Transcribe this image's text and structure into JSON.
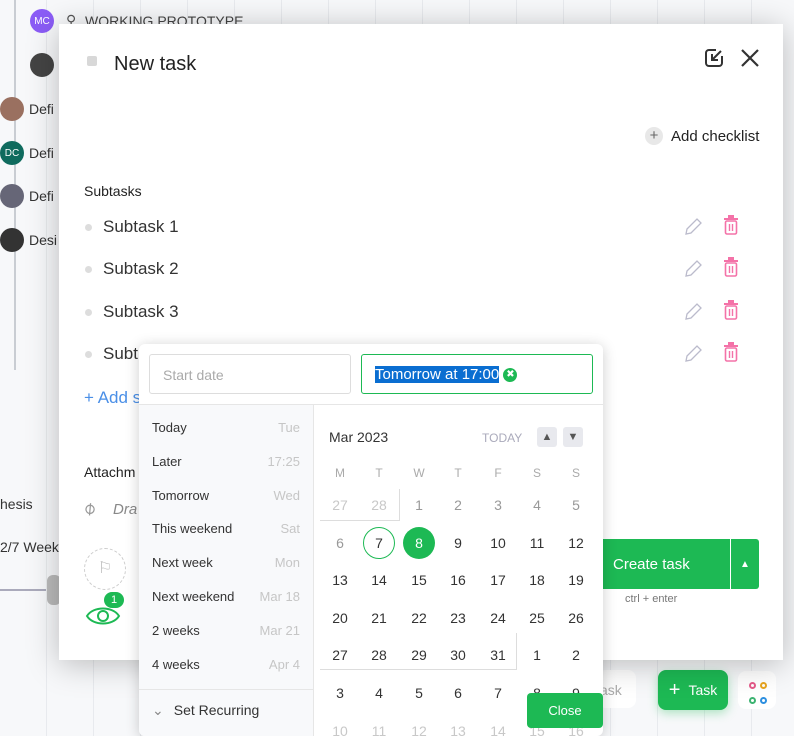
{
  "background": {
    "project_label": "WORKING PROTOTYPE",
    "avatars": [
      {
        "initials": "MC",
        "color": "#8b5cf6"
      },
      {
        "initials": "DC",
        "color": "#0f6b5e"
      }
    ],
    "rows": [
      "Defi",
      "Defi",
      "Defi",
      "Desi"
    ],
    "side_texts": [
      "hesis",
      "2/7 Week"
    ],
    "task_button": "Task",
    "task_ghost": "ask"
  },
  "modal": {
    "title": "New task",
    "add_checklist": "Add checklist",
    "subtasks_label": "Subtasks",
    "subtasks": [
      "Subtask 1",
      "Subtask 2",
      "Subtask 3",
      "Subt"
    ],
    "add_subtask": "+ Add s",
    "attachments_label": "Attachm",
    "drag_hint": "Dra",
    "watchers_count": "1",
    "create_button": "Create task",
    "shortcut": "ctrl + enter"
  },
  "datepicker": {
    "start_placeholder": "Start date",
    "due_value": "Tomorrow at 17:00",
    "quick": [
      {
        "label": "Today",
        "hint": "Tue"
      },
      {
        "label": "Later",
        "hint": "17:25"
      },
      {
        "label": "Tomorrow",
        "hint": "Wed"
      },
      {
        "label": "This weekend",
        "hint": "Sat"
      },
      {
        "label": "Next week",
        "hint": "Mon"
      },
      {
        "label": "Next weekend",
        "hint": "Mar 18"
      },
      {
        "label": "2 weeks",
        "hint": "Mar 21"
      },
      {
        "label": "4 weeks",
        "hint": "Apr 4"
      }
    ],
    "set_recurring": "Set Recurring",
    "month": "Mar 2023",
    "today_label": "TODAY",
    "weekdays": [
      "M",
      "T",
      "W",
      "T",
      "F",
      "S",
      "S"
    ],
    "weeks": [
      [
        "27",
        "28",
        "1",
        "2",
        "3",
        "4",
        "5"
      ],
      [
        "6",
        "7",
        "8",
        "9",
        "10",
        "11",
        "12"
      ],
      [
        "13",
        "14",
        "15",
        "16",
        "17",
        "18",
        "19"
      ],
      [
        "20",
        "21",
        "22",
        "23",
        "24",
        "25",
        "26"
      ],
      [
        "27",
        "28",
        "29",
        "30",
        "31",
        "1",
        "2"
      ],
      [
        "3",
        "4",
        "5",
        "6",
        "7",
        "8",
        "9"
      ],
      [
        "10",
        "11",
        "12",
        "13",
        "14",
        "15",
        "16"
      ]
    ],
    "today": "7",
    "selected": "8",
    "close": "Close",
    "accent": "#1db954"
  }
}
